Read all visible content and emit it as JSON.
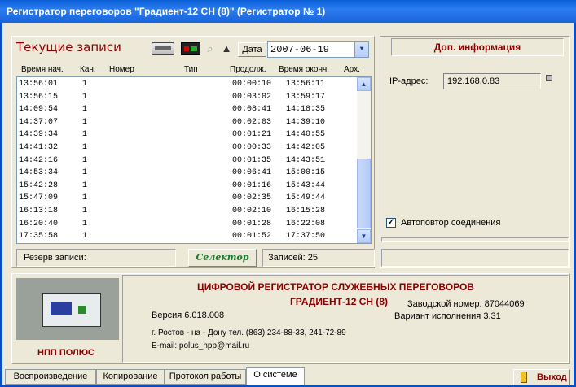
{
  "window": {
    "title": "Регистратор переговоров \"Градиент-12 СН (8)\"  (Регистратор № 1)"
  },
  "records": {
    "title": "Текущие записи",
    "date_button": "Дата",
    "date_value": "2007-06-19",
    "columns": [
      "Время нач.",
      "Кан.",
      "Номер",
      "Тип",
      "Продолж.",
      "Время оконч.",
      "Арх."
    ],
    "rows": [
      {
        "start": "13:56:01",
        "ch": "1",
        "duration": "00:00:10",
        "end": "13:56:11"
      },
      {
        "start": "13:56:15",
        "ch": "1",
        "duration": "00:03:02",
        "end": "13:59:17"
      },
      {
        "start": "14:09:54",
        "ch": "1",
        "duration": "00:08:41",
        "end": "14:18:35"
      },
      {
        "start": "14:37:07",
        "ch": "1",
        "duration": "00:02:03",
        "end": "14:39:10"
      },
      {
        "start": "14:39:34",
        "ch": "1",
        "duration": "00:01:21",
        "end": "14:40:55"
      },
      {
        "start": "14:41:32",
        "ch": "1",
        "duration": "00:00:33",
        "end": "14:42:05"
      },
      {
        "start": "14:42:16",
        "ch": "1",
        "duration": "00:01:35",
        "end": "14:43:51"
      },
      {
        "start": "14:53:34",
        "ch": "1",
        "duration": "00:06:41",
        "end": "15:00:15"
      },
      {
        "start": "15:42:28",
        "ch": "1",
        "duration": "00:01:16",
        "end": "15:43:44"
      },
      {
        "start": "15:47:09",
        "ch": "1",
        "duration": "00:02:35",
        "end": "15:49:44"
      },
      {
        "start": "16:13:18",
        "ch": "1",
        "duration": "00:02:10",
        "end": "16:15:28"
      },
      {
        "start": "16:20:40",
        "ch": "1",
        "duration": "00:01:28",
        "end": "16:22:08"
      },
      {
        "start": "17:35:58",
        "ch": "1",
        "duration": "00:01:52",
        "end": "17:37:50"
      }
    ],
    "reserve_label": "Резерв записи:",
    "selector_button": "Селектор",
    "count_label": "Записей:  25"
  },
  "extra": {
    "title": "Доп. информация",
    "ip_label": "IP-адрес:",
    "ip_value": "192.168.0.83",
    "autorepeat_label": "Автоповтор соединения",
    "autorepeat_checked": true
  },
  "system": {
    "company": "НПП ПОЛЮС",
    "title": "ЦИФРОВОЙ РЕГИСТРАТОР СЛУЖЕБНЫХ ПЕРЕГОВОРОВ",
    "model": "ГРАДИЕНТ-12 СН (8)",
    "serial": "Заводской номер:   87044069",
    "version": "Версия   6.018.008",
    "variant": "Вариант исполнения    3.31",
    "address": "г. Ростов - на - Дону  тел.  (863) 234-88-33,  241-72-89",
    "email": "E-mail: polus_npp@mail.ru"
  },
  "tabs": [
    "Воспроизведение",
    "Копирование",
    "Протокол работы",
    "О системе"
  ],
  "active_tab": "О системе",
  "exit_button": "Выход"
}
